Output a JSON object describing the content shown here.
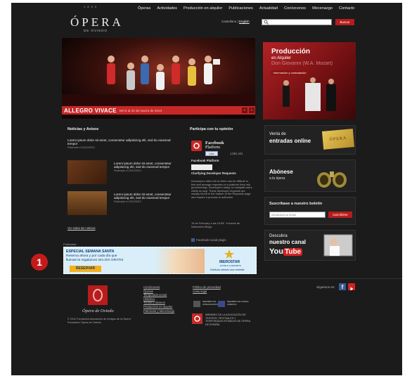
{
  "header": {
    "logo_top": "1 8 9 0",
    "logo": "ÓPERA",
    "logo_sub": "DE OVIEDO",
    "nav": [
      "Óperas",
      "Actividades",
      "Producción en alquiler",
      "Publicaciones",
      "Actualidad",
      "Conózcenos",
      "Mecenazgo",
      "Contacto"
    ],
    "lang_current": "Castellano",
    "lang_other": "English",
    "search_button": "Buscar"
  },
  "hero": {
    "title": "ALLEGRO VIVACE",
    "subtitle": "Del 5 al 22 de marzo de 2013",
    "prev": "‹",
    "next": "›"
  },
  "promo": {
    "title": "Producción",
    "subtitle": "en Alquiler",
    "faded": "Don Giovanni (W.A. Mozart)",
    "button": "Información y contratación"
  },
  "news": {
    "heading": "Noticias y Avisos",
    "items": [
      {
        "title": "Lorem ipsum dolor sit amet, consectetur adipisicing elit, sed do eiusmod tempor",
        "date": "Publicado el 15/12/2013"
      },
      {
        "title": "Lorem ipsum dolor sit amet, consectetur adipisicing elit, sed do eiusmod tempor",
        "date": "Publicado el 15/12/2013"
      },
      {
        "title": "Lorem ipsum dolor sit amet, consectetur adipisicing elit, sed do eiusmod tempor",
        "date": "Publicado el 15/12/2013"
      }
    ],
    "all_link": "Ver todas las noticias"
  },
  "social": {
    "heading": "Participa con tu opinión",
    "fb_title": "Facebook",
    "fb_sub": "Platform",
    "like": "Like",
    "count": "1,561,441",
    "section": "Facebook Platform",
    "post_title": "Clarifying Developer Requests",
    "post_body": "Developers often tell us there can be difficult to find and arrange requests on a platform they rely (prominently). Developers today, to navigate users within an app. These developer requests are usually found in the bottom of the Requests page and require a process to authorize.",
    "post_meta": "19 de February a las 19:58 · A través de Networked Blogs",
    "plugin": "Facebook social plugin"
  },
  "widgets": {
    "tickets_1": "Venta de",
    "tickets_2": "entradas online",
    "ticket_brand": "ÓPERA",
    "subscribe_1": "Abónese",
    "subscribe_2": "a la ópera",
    "newsletter_heading": "Suscríbase a nuestro boletín",
    "newsletter_placeholder": "Introduzca su email",
    "newsletter_button": "suscribirse",
    "channel_1": "Descubra",
    "channel_2": "nuestro canal",
    "youtube_a": "You",
    "youtube_b": "Tube"
  },
  "ad": {
    "label": "Publicidad",
    "line1": "ESPECIAL SEMANA SANTA",
    "line2": "Reserva ahora y por cada día que",
    "line3": "lluevas te regalamos otro DÍA GRATIS",
    "button": "RESERVAR",
    "brand": "IBEROSTAR",
    "brand_sub": "HOTELS & RESORTS",
    "tagline": "Disfruta siendo una estrella"
  },
  "callout": {
    "number": "1"
  },
  "footer": {
    "brand": "Ópera de Oviedo",
    "copyright": "© 2011 Fundación Asociación de Amigos de la Ópera · Fundación Ópera de Oviedo",
    "links_col1": [
      "Conózcanos",
      "Óperas",
      "Temporada actual",
      "Histórico",
      "Tienda y abonos",
      "Producción en alquiler",
      "Patronato y Mecenazgo"
    ],
    "links_col2": [
      "Política de privacidad",
      "Aviso legal"
    ],
    "member1": "MIEMBRO DE OPERALEUROPA",
    "member2": "MIEMBRO DE OPERA AMERICA",
    "association": "MIEMBRO DE LA ASOCIACIÓN DE TEATROS, FESTIVALES Y TEMPORADAS ESTABLES DE ÓPERA DE ESPAÑA",
    "follow": "Síguenos en:"
  }
}
